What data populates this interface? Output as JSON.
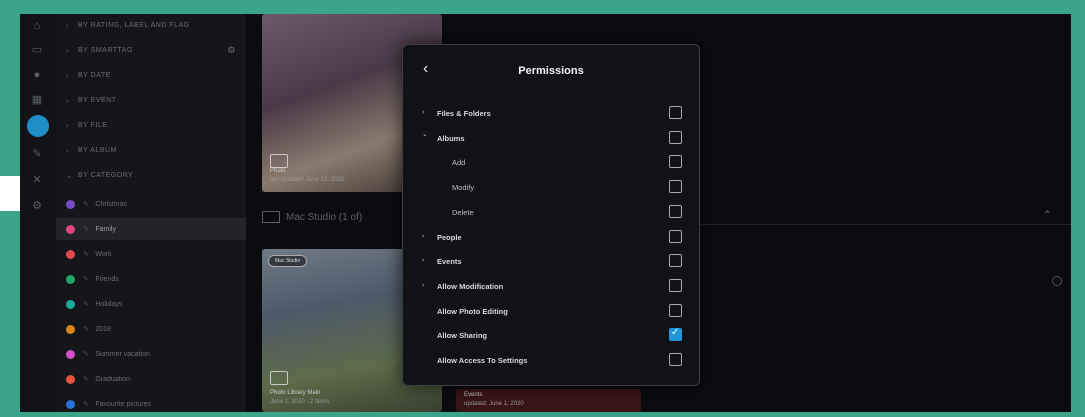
{
  "sidebar": {
    "sections": [
      {
        "label": "BY RATING, LABEL AND FLAG",
        "expanded": false,
        "selected": false,
        "has_gear": false
      },
      {
        "label": "BY SMARTTAG",
        "expanded": false,
        "selected": false,
        "has_gear": true
      },
      {
        "label": "BY DATE",
        "expanded": false,
        "selected": false,
        "has_gear": false
      },
      {
        "label": "BY EVENT",
        "expanded": false,
        "selected": false,
        "has_gear": false
      },
      {
        "label": "BY FILE",
        "expanded": false,
        "selected": false,
        "has_gear": false
      },
      {
        "label": "BY ALBUM",
        "expanded": false,
        "selected": false,
        "has_gear": false
      },
      {
        "label": "BY CATEGORY",
        "expanded": true,
        "selected": false,
        "has_gear": false
      }
    ],
    "categories": [
      {
        "label": "Christmas",
        "color": "#7a4bc9",
        "selected": false
      },
      {
        "label": "Family",
        "color": "#e0457f",
        "selected": true
      },
      {
        "label": "Work",
        "color": "#e04a4a",
        "selected": false
      },
      {
        "label": "Friends",
        "color": "#1fa86a",
        "selected": false
      },
      {
        "label": "Holidays",
        "color": "#1ba9a0",
        "selected": false
      },
      {
        "label": "2018",
        "color": "#d8861e",
        "selected": false
      },
      {
        "label": "Summer vacation",
        "color": "#d34fc9",
        "selected": false
      },
      {
        "label": "Graduation",
        "color": "#e3533b",
        "selected": false
      },
      {
        "label": "Favourite pictures",
        "color": "#2b6fd9",
        "selected": false
      }
    ]
  },
  "iconbar": {
    "icons": [
      "home-icon",
      "folder-icon",
      "person-icon",
      "calendar-icon",
      "tag-icon",
      "label-icon",
      "close-icon",
      "settings-icon"
    ]
  },
  "content": {
    "thumb1": {
      "title": "Photo",
      "subtitle": "last updated: June 13, 2020"
    },
    "device": {
      "label": "Mac Studio (1 of)"
    },
    "thumb2": {
      "badge": "Mac Studio",
      "title": "Photo Library Main",
      "subtitle": "June 1, 2020 · 2 items"
    },
    "thumb3": {
      "title": "Events",
      "subtitle": "updated: June 1, 2020"
    }
  },
  "modal": {
    "back_icon": "chevron-left-icon",
    "title": "Permissions",
    "items": [
      {
        "label": "Files & Folders",
        "indent": 0,
        "chevron": "right",
        "checked": false
      },
      {
        "label": "Albums",
        "indent": 0,
        "chevron": "down",
        "checked": false
      },
      {
        "label": "Add",
        "indent": 1,
        "chevron": "",
        "checked": false
      },
      {
        "label": "Modify",
        "indent": 1,
        "chevron": "",
        "checked": false
      },
      {
        "label": "Delete",
        "indent": 1,
        "chevron": "",
        "checked": false
      },
      {
        "label": "People",
        "indent": 0,
        "chevron": "right",
        "checked": false
      },
      {
        "label": "Events",
        "indent": 0,
        "chevron": "right",
        "checked": false
      },
      {
        "label": "Allow Modification",
        "indent": 0,
        "chevron": "right",
        "checked": false
      },
      {
        "label": "Allow Photo Editing",
        "indent": 0,
        "chevron": "",
        "checked": false
      },
      {
        "label": "Allow Sharing",
        "indent": 0,
        "chevron": "",
        "checked": true
      },
      {
        "label": "Allow Access To Settings",
        "indent": 0,
        "chevron": "",
        "checked": false
      }
    ]
  }
}
